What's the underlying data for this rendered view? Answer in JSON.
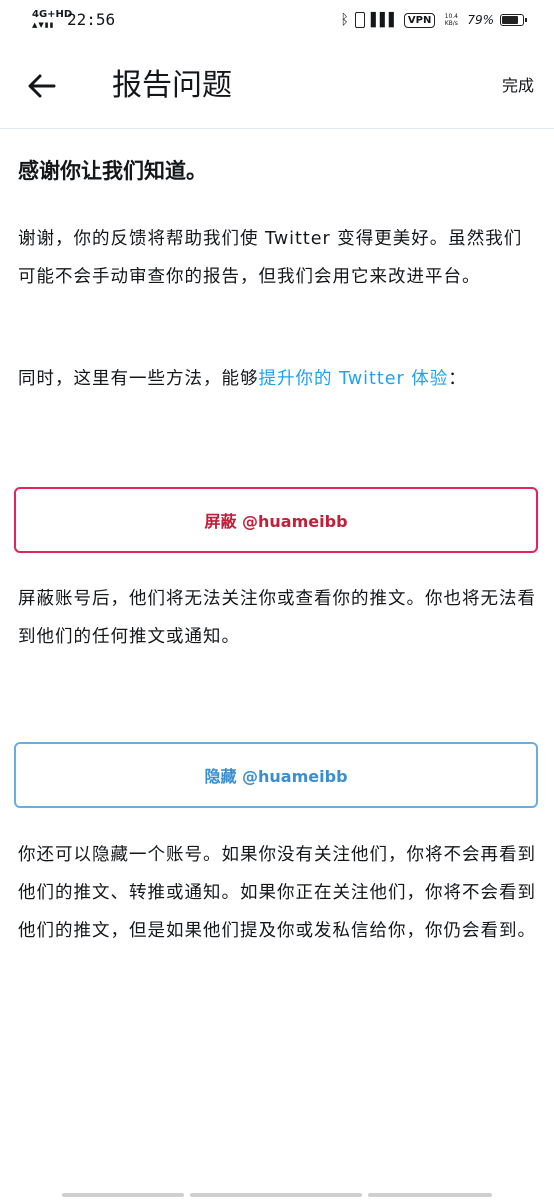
{
  "status_bar": {
    "network": "4G+HD",
    "time": "22:56",
    "vpn": "VPN",
    "speed_value": "10.4",
    "speed_unit": "KB/s",
    "battery": "79%",
    "battery_level": 0.79
  },
  "header": {
    "title": "报告问题",
    "done_label": "完成"
  },
  "content": {
    "heading": "感谢你让我们知道。",
    "intro": "谢谢，你的反馈将帮助我们使 Twitter 变得更美好。虽然我们可能不会手动审查你的报告，但我们会用它来改进平台。",
    "tips_prefix": "同时，这里有一些方法，能够",
    "tips_link": "提升你的 Twitter 体验",
    "tips_suffix": "：",
    "block_button": "屏蔽 @huameibb",
    "block_desc": "屏蔽账号后，他们将无法关注你或查看你的推文。你也将无法看到他们的任何推文或通知。",
    "mute_button": "隐藏 @huameibb",
    "mute_desc": "你还可以隐藏一个账号。如果你没有关注他们，你将不会再看到他们的推文、转推或通知。如果你正在关注他们，你将不会看到他们的推文，但是如果他们提及你或发私信给你，你仍会看到。"
  },
  "colors": {
    "link": "#1da1f2",
    "block": "#e0245e",
    "mute": "#6aaee0"
  }
}
